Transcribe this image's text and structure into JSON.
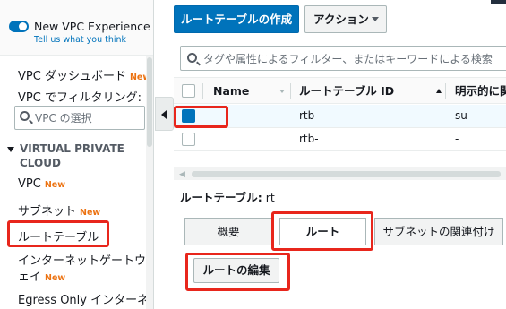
{
  "sidebar": {
    "vpc_experience": {
      "title": "New VPC Experience",
      "link": "Tell us what you think"
    },
    "dashboard": {
      "label": "VPC ダッシュボード",
      "badge": "New"
    },
    "filter_label": "VPC でフィルタリング:",
    "vpc_select_placeholder": "VPC の選択",
    "section": "VIRTUAL PRIVATE CLOUD",
    "items": [
      {
        "label": "VPC",
        "badge": "New"
      },
      {
        "label": "サブネット",
        "badge": "New"
      },
      {
        "label": "ルートテーブル"
      },
      {
        "label_line1": "インターネットゲートウ",
        "label_line2": "ェイ",
        "badge": "New"
      },
      {
        "label_line1": "Egress Only インターネ"
      }
    ]
  },
  "toolbar": {
    "create_label": "ルートテーブルの作成",
    "actions_label": "アクション"
  },
  "search": {
    "placeholder": "タグや属性によるフィルター、またはキーワードによる検索"
  },
  "table": {
    "columns": [
      "Name",
      "ルートテーブル ID",
      "明示的に関"
    ],
    "rows": [
      {
        "name": "",
        "id": "rtb",
        "explicit": "su",
        "selected": true
      },
      {
        "name": "",
        "id": "rtb-",
        "explicit": "-",
        "selected": false
      }
    ]
  },
  "details": {
    "title_label": "ルートテーブル:",
    "title_value": "rt",
    "tabs": [
      "概要",
      "ルート",
      "サブネットの関連付け"
    ],
    "active_tab": "ルート",
    "edit_routes_label": "ルートの編集"
  },
  "colors": {
    "primary": "#0073bb",
    "highlight": "#e8261c",
    "new_badge": "#ec7211"
  }
}
